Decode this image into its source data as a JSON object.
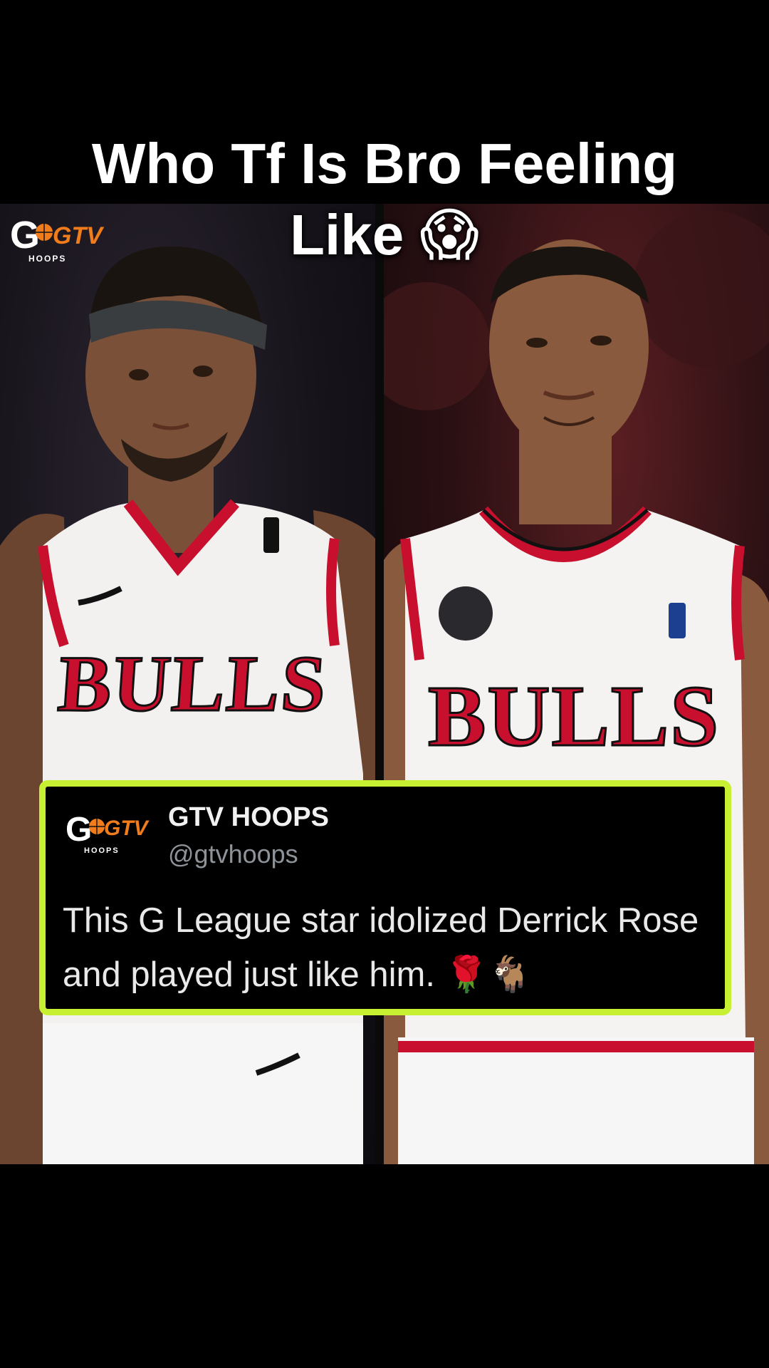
{
  "headline": {
    "text": "Who Tf Is Bro Feeling Like",
    "emoji": "😱"
  },
  "corner_logo": {
    "brand": "GTV",
    "sub": "HOOPS",
    "icon": "basketball-icon"
  },
  "left_player": {
    "jersey_text": "BULLS"
  },
  "right_player": {
    "jersey_text": "BULLS"
  },
  "tweet": {
    "name": "GTV HOOPS",
    "handle": "@gtvhoops",
    "text": "This G League star idolized Derrick Rose and played just like him.",
    "emojis": "🌹🐐",
    "avatar_brand": "GTV",
    "avatar_sub": "HOOPS"
  },
  "colors": {
    "background": "#000000",
    "card_border": "#c8f032",
    "bulls_red": "#c8102e",
    "text_white": "#ffffff",
    "handle_gray": "#8e9399"
  }
}
